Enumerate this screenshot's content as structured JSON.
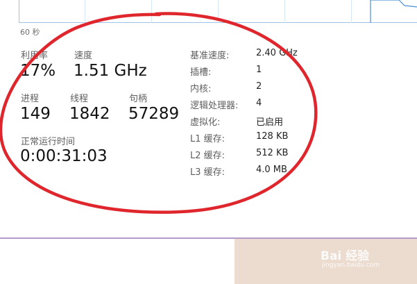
{
  "graph": {
    "time_label": "60 秒"
  },
  "stats": {
    "utilization": {
      "label": "利用率",
      "value": "17%"
    },
    "speed": {
      "label": "速度",
      "value": "1.51 GHz"
    },
    "processes": {
      "label": "进程",
      "value": "149"
    },
    "threads": {
      "label": "线程",
      "value": "1842"
    },
    "handles": {
      "label": "句柄",
      "value": "57289"
    },
    "uptime": {
      "label": "正常运行时间",
      "value": "0:00:31:03"
    }
  },
  "details": [
    {
      "label": "基准速度:",
      "value": "2.40 GHz"
    },
    {
      "label": "插槽:",
      "value": "1"
    },
    {
      "label": "内核:",
      "value": "2"
    },
    {
      "label": "逻辑处理器:",
      "value": "4"
    },
    {
      "label": "虚拟化:",
      "value": "已启用"
    },
    {
      "label": "L1 缓存:",
      "value": "128 KB"
    },
    {
      "label": "L2 缓存:",
      "value": "512 KB"
    },
    {
      "label": "L3 缓存:",
      "value": "4.0 MB"
    }
  ],
  "watermark": {
    "brand": "Bai 经验",
    "url": "jingyan.baidu.com"
  },
  "colors": {
    "annotation_red": "#e0262d",
    "graph_blue": "#4a90d6",
    "divider_purple": "#b39ac9",
    "tan": "#ecdcd0"
  }
}
